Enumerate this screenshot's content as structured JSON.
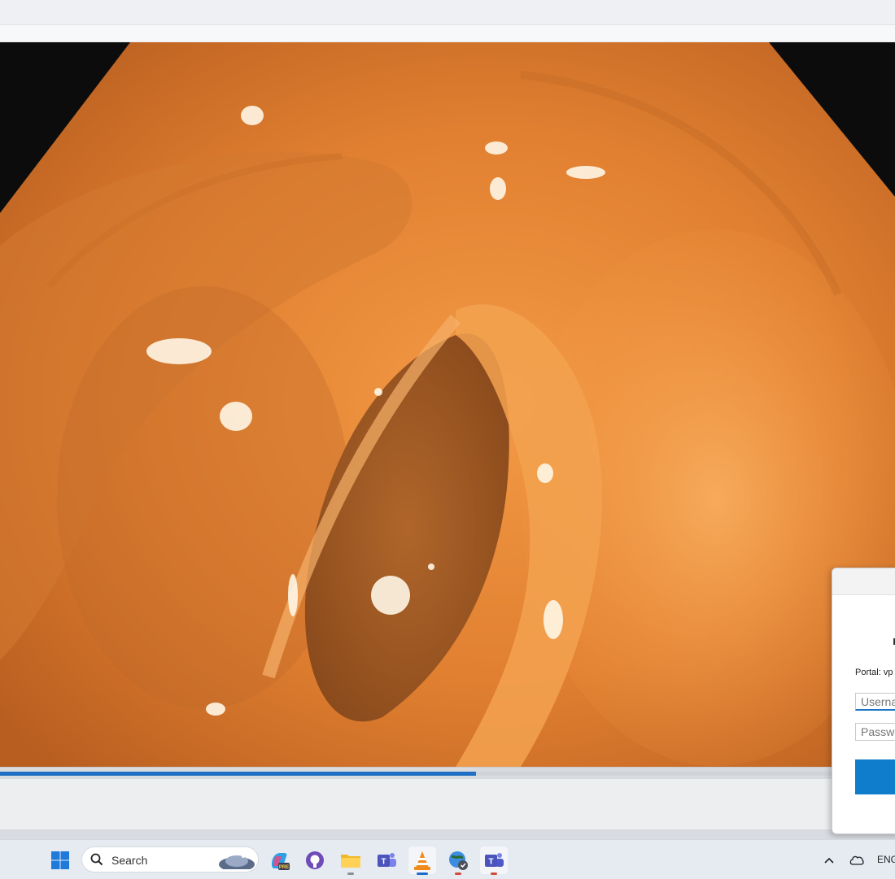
{
  "player": {
    "progress_fraction": 0.532
  },
  "vpn_dialog": {
    "portal_label": "Portal: vp",
    "username_placeholder": "Userna",
    "password_placeholder": "Passwo"
  },
  "taskbar": {
    "search_placeholder": "Search",
    "language": "ENG",
    "apps": [
      {
        "icon": "start-icon"
      },
      {
        "icon": "copilot-icon",
        "badge": "PRE"
      },
      {
        "icon": "github-icon"
      },
      {
        "icon": "file-explorer-icon"
      },
      {
        "icon": "teams-icon"
      },
      {
        "icon": "vlc-icon"
      },
      {
        "icon": "vpn-globe-icon"
      },
      {
        "icon": "teams-new-icon"
      }
    ]
  },
  "colors": {
    "accent": "#1f6fc5",
    "taskbar_bg": "#e6ebf2"
  }
}
